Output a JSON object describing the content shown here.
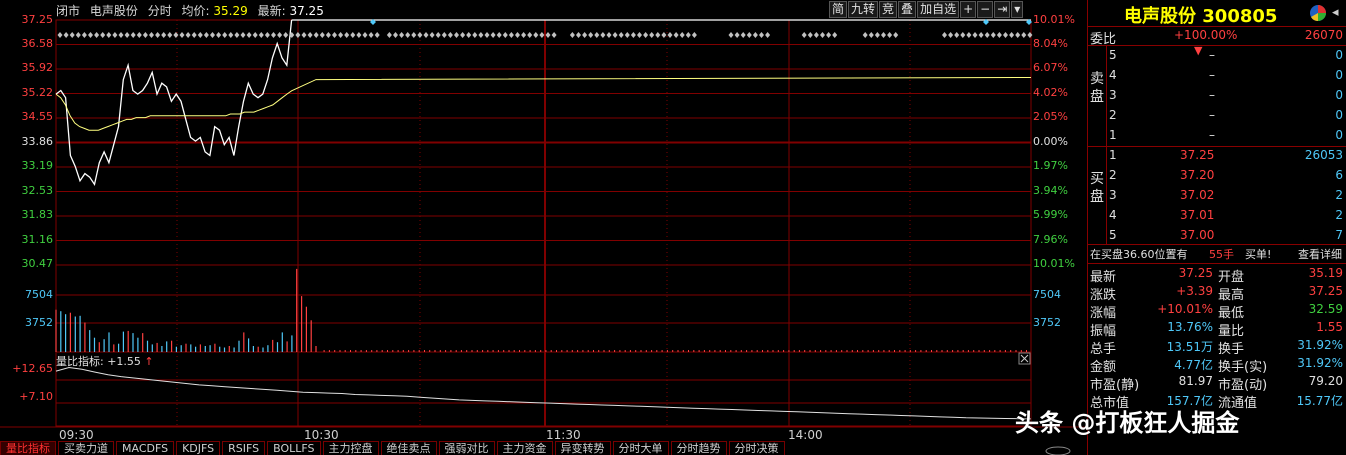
{
  "topbar": {
    "status": "闭市",
    "name": "电声股份",
    "mode": "分时",
    "avg_label": "均价:",
    "avg_value": "35.29",
    "last_label": "最新:",
    "last_value": "37.25"
  },
  "toolbar": [
    "简",
    "九转",
    "竞",
    "叠",
    "加自选",
    "+",
    "−",
    "⇥",
    "▾"
  ],
  "price_axis": [
    "37.25",
    "36.58",
    "35.92",
    "35.22",
    "34.55",
    "33.86",
    "33.19",
    "32.53",
    "31.83",
    "31.16",
    "30.47"
  ],
  "pct_axis": [
    "10.01%",
    "8.04%",
    "6.07%",
    "4.02%",
    "2.05%",
    "0.00%",
    "1.97%",
    "3.94%",
    "5.99%",
    "7.96%",
    "10.01%"
  ],
  "volume_axis": [
    "7504",
    "3752"
  ],
  "volume_axis_right": [
    "7504",
    "3752"
  ],
  "ratio_panel": {
    "label": "量比指标: +1.55",
    "arrow": "↑",
    "axis": [
      "+12.65",
      "+7.10"
    ]
  },
  "time_axis": [
    "09:30",
    "10:30",
    "11:30",
    "14:00"
  ],
  "tabs": [
    "量比指标",
    "买卖力道",
    "MACDFS",
    "KDJFS",
    "RSIFS",
    "BOLLFS",
    "主力控盘",
    "绝佳卖点",
    "强弱对比",
    "主力资金",
    "异变转势",
    "分时大单",
    "分时趋势",
    "分时决策"
  ],
  "colors": {
    "up": "#ff4040",
    "down": "#40d040",
    "price_line": "#ffffff",
    "avg_line": "#ffff80",
    "grid": "#800000",
    "volume": "#4fc8f8"
  },
  "chart_data": {
    "type": "line",
    "price_ylim": [
      30.47,
      37.25
    ],
    "prev_close": 33.86,
    "price": [
      35.2,
      35.3,
      35.1,
      33.5,
      33.2,
      32.8,
      33.0,
      32.9,
      32.7,
      33.3,
      33.6,
      33.3,
      33.8,
      34.3,
      35.6,
      36.0,
      35.3,
      35.2,
      35.3,
      35.5,
      35.8,
      35.2,
      35.5,
      35.4,
      35.0,
      35.2,
      35.0,
      34.5,
      34.0,
      33.9,
      34.0,
      33.6,
      33.5,
      34.3,
      34.2,
      33.8,
      34.0,
      33.5,
      34.3,
      35.0,
      35.5,
      35.2,
      35.1,
      35.2,
      35.6,
      36.2,
      36.6,
      36.2,
      36.0,
      37.25
    ],
    "avg_price": [
      35.2,
      35.1,
      34.9,
      34.6,
      34.4,
      34.3,
      34.25,
      34.2,
      34.2,
      34.2,
      34.25,
      34.3,
      34.35,
      34.4,
      34.45,
      34.5,
      34.5,
      34.55,
      34.55,
      34.55,
      34.6,
      34.6,
      34.6,
      34.6,
      34.6,
      34.6,
      34.6,
      34.6,
      34.6,
      34.6,
      34.6,
      34.6,
      34.6,
      34.6,
      34.6,
      34.6,
      34.6,
      34.65,
      34.65,
      34.65,
      34.7,
      34.7,
      34.7,
      34.75,
      34.8,
      34.85,
      34.9,
      35.0,
      35.1,
      35.2,
      35.29
    ],
    "volume_ylim": [
      0,
      11256
    ],
    "volume": [
      5600,
      5400,
      5000,
      5200,
      4700,
      4800,
      3900,
      2900,
      1900,
      1300,
      1700,
      2600,
      1000,
      1100,
      2700,
      2800,
      2500,
      1900,
      2500,
      1500,
      1000,
      1200,
      800,
      1400,
      1500,
      700,
      900,
      1100,
      1000,
      700,
      1000,
      800,
      900,
      1100,
      700,
      600,
      800,
      600,
      1500,
      2600,
      1800,
      800,
      700,
      600,
      900,
      1600,
      1300,
      2600,
      1400,
      2200,
      11000,
      7400,
      6000,
      4200,
      800
    ],
    "ratio_ylim": [
      0,
      14
    ],
    "ratio": [
      12.0,
      12.8,
      12.4,
      11.8,
      11.2,
      10.8,
      10.5,
      10.2,
      9.9,
      9.6,
      9.3,
      9.0,
      8.8,
      8.6,
      8.4,
      8.2,
      8.0,
      7.8,
      7.6,
      7.4,
      7.3,
      7.2,
      7.1,
      6.9,
      6.8,
      6.7,
      6.6,
      6.5,
      6.3,
      6.1,
      5.9,
      5.7,
      5.6,
      5.5,
      5.4,
      5.3,
      5.2,
      5.1,
      5.0,
      4.9,
      4.8,
      4.7,
      4.6,
      4.5,
      4.4,
      4.3,
      4.2,
      4.1,
      4.0,
      3.9,
      3.8,
      3.7,
      3.6,
      3.5,
      3.4,
      3.3,
      3.2,
      3.1,
      3.0,
      2.9,
      2.8,
      2.7,
      2.6,
      2.5,
      2.4,
      2.3,
      2.2,
      2.1,
      2.0,
      1.9,
      1.8,
      1.75,
      1.7,
      1.65,
      1.6,
      1.55
    ]
  },
  "panel": {
    "stock_name": "电声股份",
    "stock_code": "300805",
    "weibi_label": "委比",
    "weibi_value": "+100.00%",
    "weicha_value": "26070",
    "sell_side_label": "卖盘",
    "buy_side_label": "买盘",
    "sell": [
      {
        "level": "5",
        "price": "–",
        "vol": "0"
      },
      {
        "level": "4",
        "price": "–",
        "vol": "0"
      },
      {
        "level": "3",
        "price": "–",
        "vol": "0"
      },
      {
        "level": "2",
        "price": "–",
        "vol": "0"
      },
      {
        "level": "1",
        "price": "–",
        "vol": "0"
      }
    ],
    "buy": [
      {
        "level": "1",
        "price": "37.25",
        "vol": "26053"
      },
      {
        "level": "2",
        "price": "37.20",
        "vol": "6"
      },
      {
        "level": "3",
        "price": "37.02",
        "vol": "2"
      },
      {
        "level": "4",
        "price": "37.01",
        "vol": "2"
      },
      {
        "level": "5",
        "price": "37.00",
        "vol": "7"
      }
    ],
    "info_line": {
      "text": "在买盘36.60位置有",
      "hands": "55手",
      "act": "买单!",
      "detail": "查看详细"
    },
    "stats": [
      {
        "l1": "最新",
        "v1": "37.25",
        "c1": "up",
        "l2": "开盘",
        "v2": "35.19",
        "c2": "up"
      },
      {
        "l1": "涨跌",
        "v1": "+3.39",
        "c1": "up",
        "l2": "最高",
        "v2": "37.25",
        "c2": "up"
      },
      {
        "l1": "涨幅",
        "v1": "+10.01%",
        "c1": "up",
        "l2": "最低",
        "v2": "32.59",
        "c2": "dn"
      },
      {
        "l1": "振幅",
        "v1": "13.76%",
        "c1": "cy",
        "l2": "量比",
        "v2": "1.55",
        "c2": "up"
      },
      {
        "l1": "总手",
        "v1": "13.51万",
        "c1": "cy",
        "l2": "换手",
        "v2": "31.92%",
        "c2": "cy"
      },
      {
        "l1": "金额",
        "v1": "4.77亿",
        "c1": "cy",
        "l2": "换手(实)",
        "v2": "31.92%",
        "c2": "cy"
      },
      {
        "l1": "市盈(静)",
        "v1": "81.97",
        "c1": "wt",
        "l2": "市盈(动)",
        "v2": "79.20",
        "c2": "wt"
      },
      {
        "l1": "总市值",
        "v1": "157.7亿",
        "c1": "cy",
        "l2": "流通值",
        "v2": "15.77亿",
        "c2": "cy"
      }
    ]
  },
  "watermark": "头条 @打板狂人掘金"
}
